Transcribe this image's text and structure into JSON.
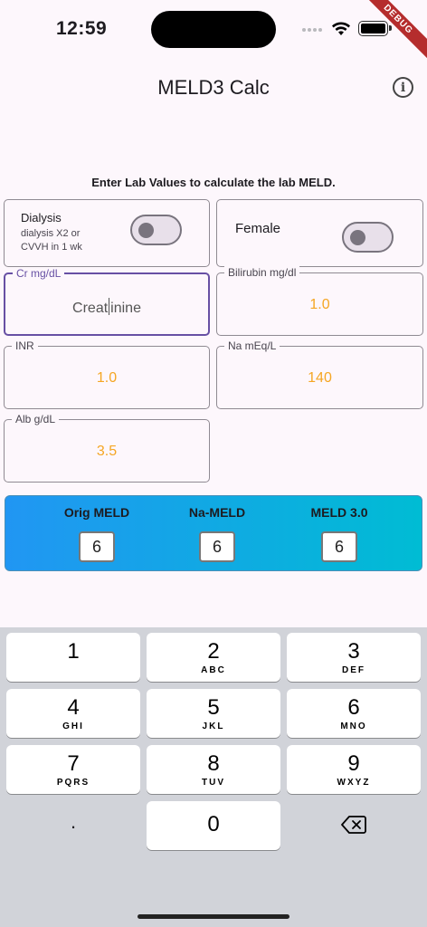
{
  "status": {
    "time": "12:59",
    "debug_label": "DEBUG"
  },
  "header": {
    "title": "MELD3 Calc",
    "info_icon": "info-icon"
  },
  "instructions": "Enter Lab Values to calculate the lab MELD.",
  "toggles": {
    "dialysis": {
      "title": "Dialysis",
      "subtitle_line1": "dialysis X2 or",
      "subtitle_line2": "CVVH in 1 wk",
      "on": false
    },
    "female": {
      "title": "Female",
      "on": false
    }
  },
  "fields": {
    "cr": {
      "label": "Cr mg/dL",
      "value_before_caret": "Creat",
      "value_after_caret": "inine",
      "focused": true
    },
    "bilirubin": {
      "label": "Bilirubin mg/dl",
      "value": "1.0"
    },
    "inr": {
      "label": "INR",
      "value": "1.0"
    },
    "na": {
      "label": "Na mEq/L",
      "value": "140"
    },
    "alb": {
      "label": "Alb g/dL",
      "value": "3.5"
    }
  },
  "results": {
    "orig_meld": {
      "label": "Orig MELD",
      "value": "6"
    },
    "na_meld": {
      "label": "Na-MELD",
      "value": "6"
    },
    "meld3": {
      "label": "MELD 3.0",
      "value": "6"
    }
  },
  "keyboard": {
    "keys": [
      {
        "num": "1",
        "letters": ""
      },
      {
        "num": "2",
        "letters": "ABC"
      },
      {
        "num": "3",
        "letters": "DEF"
      },
      {
        "num": "4",
        "letters": "GHI"
      },
      {
        "num": "5",
        "letters": "JKL"
      },
      {
        "num": "6",
        "letters": "MNO"
      },
      {
        "num": "7",
        "letters": "PQRS"
      },
      {
        "num": "8",
        "letters": "TUV"
      },
      {
        "num": "9",
        "letters": "WXYZ"
      }
    ],
    "dot": ".",
    "zero": "0",
    "delete_icon": "backspace-icon"
  },
  "colors": {
    "accent": "#6750a4",
    "value": "#f5a623",
    "gradient_start": "#2196f3",
    "gradient_end": "#00bcd4"
  }
}
